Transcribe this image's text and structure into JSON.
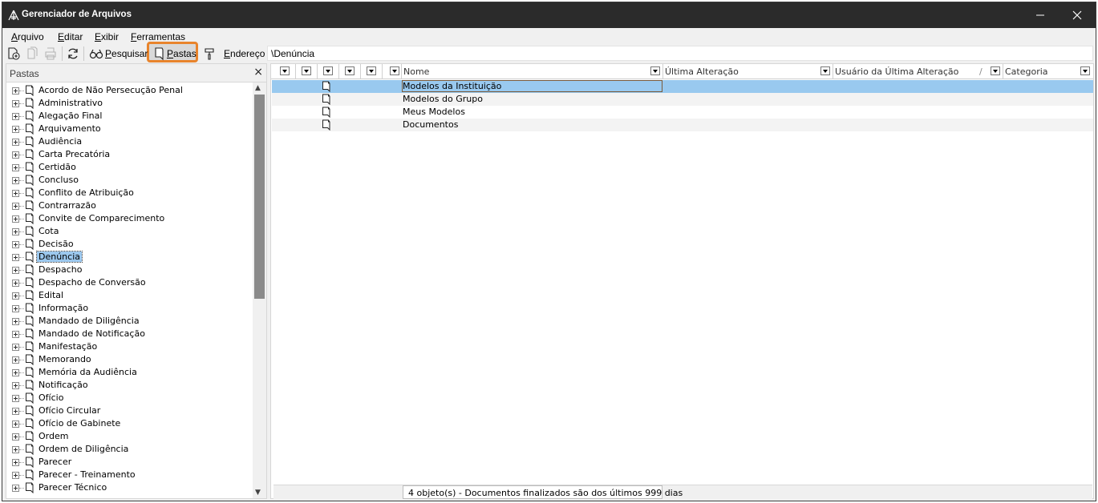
{
  "window": {
    "title": "Gerenciador de Arquivos"
  },
  "menu": [
    "Arquivo",
    "Editar",
    "Exibir",
    "Ferramentas"
  ],
  "toolbar": {
    "pesquisar_label": "Pesquisar",
    "pastas_label": "Pastas",
    "endereco_label": "Endereço",
    "address_value": "\\Denúncia",
    "highlight_color": "#e8842c"
  },
  "folders_panel": {
    "title": "Pastas",
    "close_glyph": "×",
    "items": [
      "Acordo de Não Persecução Penal",
      "Administrativo",
      "Alegação Final",
      "Arquivamento",
      "Audiência",
      "Carta Precatória",
      "Certidão",
      "Concluso",
      "Conflito de Atribuição",
      "Contrarrazão",
      "Convite de Comparecimento",
      "Cota",
      "Decisão",
      "Denúncia",
      "Despacho",
      "Despacho de Conversão",
      "Edital",
      "Informação",
      "Mandado de Diligência",
      "Mandado de Notificação",
      "Manifestação",
      "Memorando",
      "Memória da Audiência",
      "Notificação",
      "Ofício",
      "Ofício Circular",
      "Ofício de Gabinete",
      "Ordem",
      "Ordem de Diligência",
      "Parecer",
      "Parecer - Treinamento",
      "Parecer Técnico"
    ],
    "selected": "Denúncia",
    "selection_color": "#9cc8ee"
  },
  "file_list": {
    "columns": {
      "nome": "Nome",
      "ultima_alteracao": "Última Alteração",
      "usuario": "Usuário da Última Alteração",
      "categoria": "Categoria"
    },
    "rows": [
      "Modelos da Instituição",
      "Modelos do Grupo",
      "Meus Modelos",
      "Documentos"
    ],
    "selected_row": "Modelos da Instituição",
    "selection_color": "#99c9ef"
  },
  "status": {
    "text": "4 objeto(s) - Documentos finalizados são dos últimos 999 dias"
  }
}
